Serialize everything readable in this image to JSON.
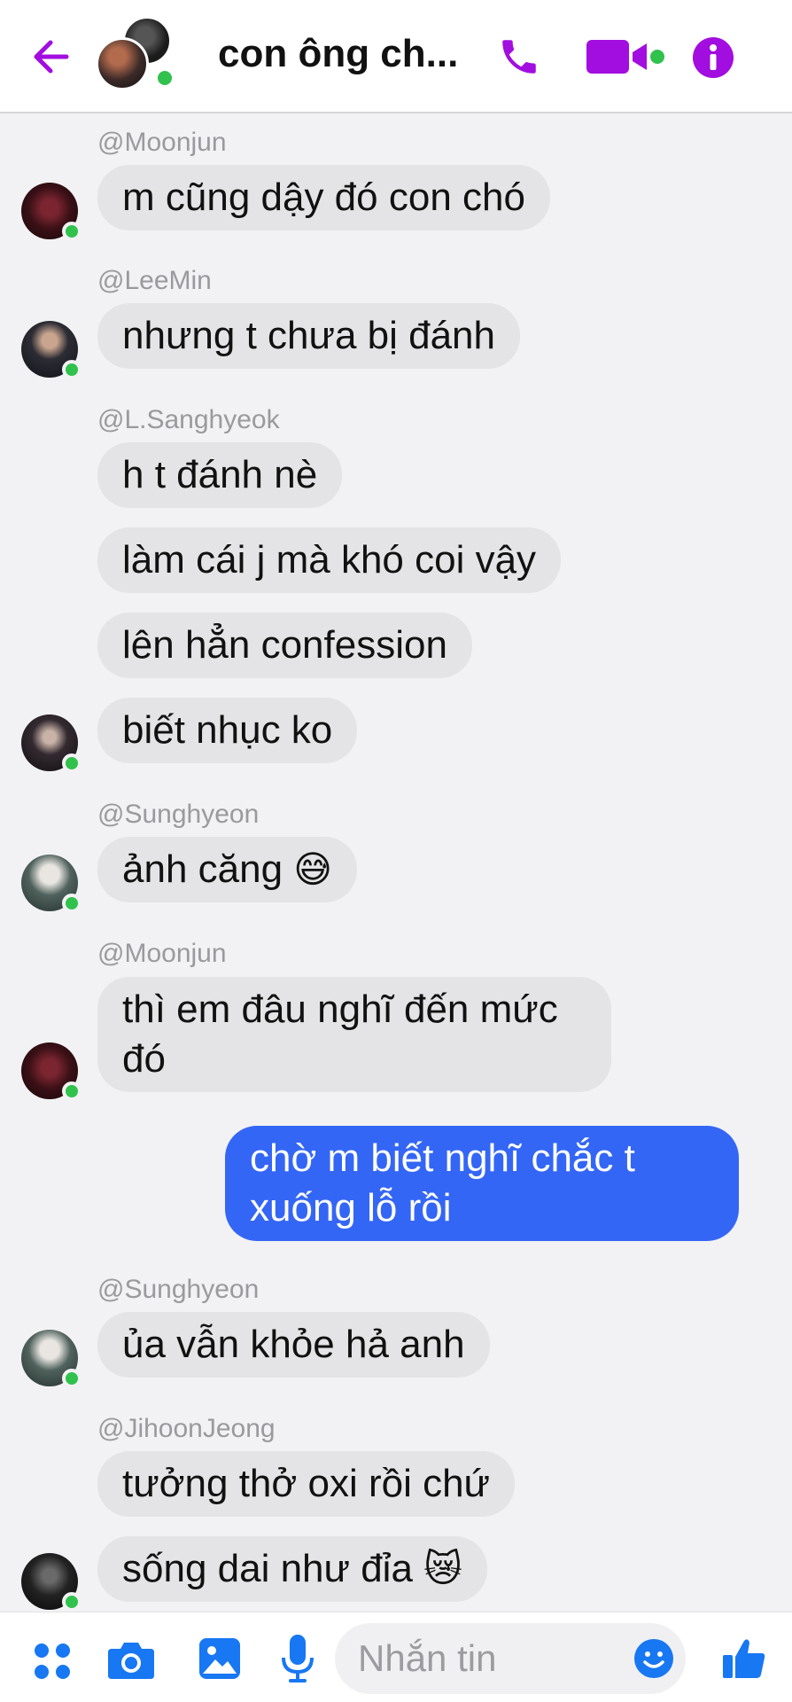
{
  "header": {
    "title": "con ông ch...",
    "accent_color": "#a20de0",
    "online_color": "#31c14d",
    "icons": [
      "back-arrow-icon",
      "phone-icon",
      "video-camera-icon",
      "info-icon"
    ]
  },
  "messages": [
    {
      "sender": "@Moonjun",
      "text": "m cũng dậy đó con chó"
    },
    {
      "sender": "@LeeMin",
      "text": "nhưng t chưa bị đánh"
    },
    {
      "sender": "@L.Sanghyeok",
      "text": "h t đánh nè"
    },
    {
      "text": "làm cái j mà khó coi vậy"
    },
    {
      "text": "lên hẳn confession"
    },
    {
      "text": "biết nhục ko"
    },
    {
      "sender": "@Sunghyeon",
      "text": "ảnh căng",
      "emoji": "😅"
    },
    {
      "sender": "@Moonjun",
      "text": "thì em đâu nghĩ đến mức đó"
    },
    {
      "text": "chờ m biết nghĩ chắc t xuống lỗ rồi",
      "own": true
    },
    {
      "sender": "@Sunghyeon",
      "text": "ủa vẫn khỏe hả anh"
    },
    {
      "sender": "@JihoonJeong",
      "text": "tưởng thở oxi rồi chứ"
    },
    {
      "text": "sống dai như đỉa",
      "emoji": "😿"
    }
  ],
  "composer": {
    "placeholder": "Nhắn tin",
    "accent_color": "#1877f2",
    "icons": [
      "grid-dots-icon",
      "camera-icon",
      "image-icon",
      "microphone-icon",
      "smiley-icon",
      "thumbs-up-icon"
    ]
  }
}
